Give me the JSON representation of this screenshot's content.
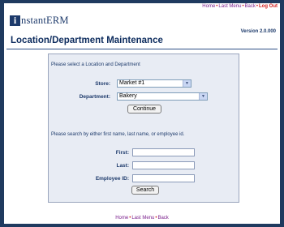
{
  "top_nav": {
    "home": "Home",
    "last_menu": "Last Menu",
    "back": "Back",
    "logout": "Log Out",
    "separator": "•"
  },
  "brand": {
    "logo_letter": "i",
    "logo_text": "nstantERM"
  },
  "version": "Version 2.0.000",
  "page_title": "Location/Department Maintenance",
  "location_form": {
    "instruction": "Please select a Location and Department",
    "store_label": "Store:",
    "store_value": "Market #1",
    "department_label": "Department:",
    "department_value": "Bakery",
    "continue_label": "Continue"
  },
  "search_form": {
    "instruction": "Please search by either first name, last name, or employee id.",
    "first_label": "First:",
    "last_label": "Last:",
    "employee_id_label": "Employee ID:",
    "first_value": "",
    "last_value": "",
    "employee_id_value": "",
    "search_label": "Search"
  },
  "bottom_nav": {
    "home": "Home",
    "last_menu": "Last Menu",
    "back": "Back",
    "separator": "•"
  },
  "icons": {
    "dropdown_arrow": "chevron-down-icon"
  },
  "colors": {
    "brand_navy": "#1d3a6b",
    "link_purple": "#7a1f8c",
    "logout_red": "#d01c1c",
    "panel_bg": "#e8ecf4",
    "page_border": "#1f3a5f"
  }
}
